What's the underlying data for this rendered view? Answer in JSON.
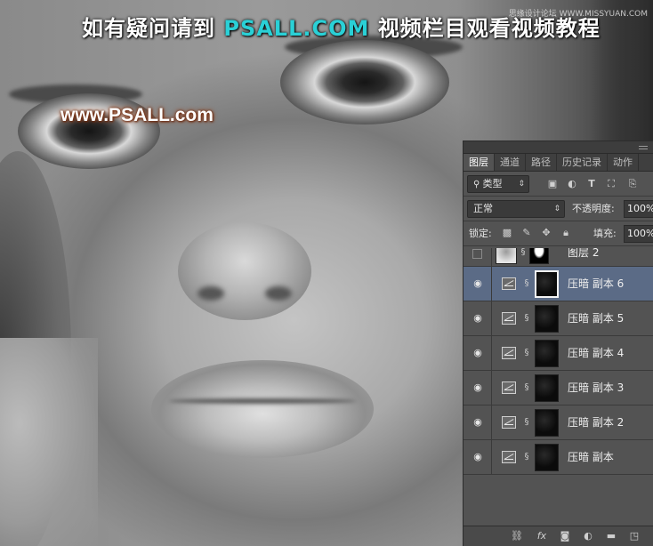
{
  "watermark": {
    "banner_pre": "如有疑问请到 ",
    "banner_accent": "PSALL.COM",
    "banner_post": " 视频栏目观看视频教程",
    "site": "www.PSALL.com",
    "corner": "思缘设计论坛  WWW.MISSYUAN.COM"
  },
  "panel": {
    "tabs": [
      "图层",
      "通道",
      "路径",
      "历史记录",
      "动作"
    ],
    "active_tab": "图层",
    "filter": {
      "label": "类型",
      "icons": [
        "image-filter-icon",
        "adjustment-filter-icon",
        "type-filter-icon",
        "shape-filter-icon",
        "smart-object-filter-icon"
      ]
    },
    "blend_mode": "正常",
    "opacity": {
      "label": "不透明度:",
      "value": "100%"
    },
    "lock": {
      "label": "锁定:",
      "icons": [
        "lock-transparent-icon",
        "lock-image-icon",
        "lock-position-icon",
        "lock-all-icon"
      ]
    },
    "fill": {
      "label": "填充:",
      "value": "100%"
    },
    "layers": [
      {
        "name": "图层 2",
        "type": "pixel",
        "visible": false,
        "selected": false,
        "partial": true
      },
      {
        "name": "压暗 副本 6",
        "type": "curves",
        "visible": true,
        "selected": true
      },
      {
        "name": "压暗 副本 5",
        "type": "curves",
        "visible": true,
        "selected": false
      },
      {
        "name": "压暗 副本 4",
        "type": "curves",
        "visible": true,
        "selected": false
      },
      {
        "name": "压暗 副本 3",
        "type": "curves",
        "visible": true,
        "selected": false
      },
      {
        "name": "压暗 副本 2",
        "type": "curves",
        "visible": true,
        "selected": false
      },
      {
        "name": "压暗 副本",
        "type": "curves",
        "visible": true,
        "selected": false
      }
    ],
    "bottom_icons": [
      "link-layers-icon",
      "fx-icon",
      "add-mask-icon",
      "adjustment-layer-icon",
      "new-group-icon",
      "new-layer-icon"
    ],
    "colors": {
      "panel_bg": "#535353",
      "selected_row": "#5b6b86",
      "accent_text": "#2ad0d6"
    }
  }
}
